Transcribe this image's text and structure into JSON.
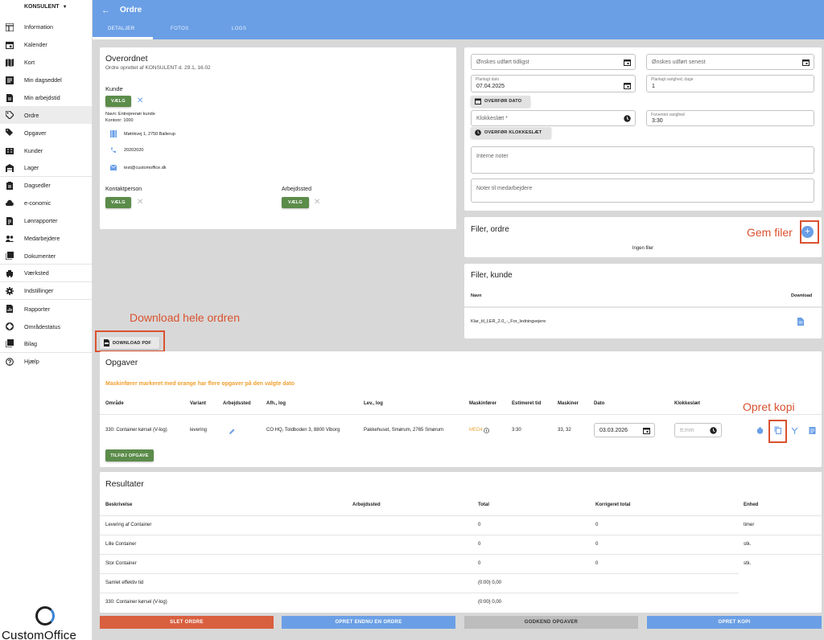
{
  "sidebar": {
    "user": "KONSULENT",
    "items": [
      {
        "label": "Information",
        "icon": "dashboard-icon"
      },
      {
        "label": "Kalender",
        "icon": "calendar-icon"
      },
      {
        "label": "Kort",
        "icon": "map-icon"
      },
      {
        "label": "Min dagseddel",
        "icon": "day-sheet-icon"
      },
      {
        "label": "Min arbejdstid",
        "icon": "worktime-icon"
      },
      {
        "label": "Ordre",
        "icon": "tag-icon"
      },
      {
        "label": "Opgaver",
        "icon": "tasks-icon"
      },
      {
        "label": "Kunder",
        "icon": "customers-icon"
      },
      {
        "label": "Lager",
        "icon": "warehouse-icon"
      },
      {
        "label": "Dagsedler",
        "icon": "clipboard-icon"
      },
      {
        "label": "e-conomic",
        "icon": "cloud-icon"
      },
      {
        "label": "Lønrapporter",
        "icon": "report-icon"
      },
      {
        "label": "Medarbejdere",
        "icon": "people-icon"
      },
      {
        "label": "Dokumenter",
        "icon": "documents-icon"
      },
      {
        "label": "Værksted",
        "icon": "workshop-icon"
      },
      {
        "label": "Indstillinger",
        "icon": "gear-icon"
      },
      {
        "label": "Rapporter",
        "icon": "chart-report-icon"
      },
      {
        "label": "Områdestatus",
        "icon": "area-status-icon"
      },
      {
        "label": "Bilag",
        "icon": "attachments-icon"
      },
      {
        "label": "Hjælp",
        "icon": "help-icon"
      }
    ],
    "logo_text": "CustomOffice"
  },
  "header": {
    "title": "Ordre",
    "tabs": [
      "DETALJER",
      "FOTOS",
      "LOGS"
    ]
  },
  "overview": {
    "title": "Overordnet",
    "subtitle": "Ordre oprettet af KONSULENT d. 29.1, 16.02",
    "customer_heading": "Kunde",
    "select_label": "VÆLG",
    "customer_name": "Navn: Entreprenør kunde",
    "customer_no": "Kontonr: 1000",
    "address": "Møtrikvej 1, 2750 Ballerup",
    "phone": "20202020",
    "email": "test@customoffice.dk",
    "contact_heading": "Kontaktperson",
    "workplace_heading": "Arbejdssted"
  },
  "dates": {
    "earliest_placeholder": "Ønskes udført tidligst",
    "latest_placeholder": "Ønskes udført senest",
    "planned_date_label": "Planlagt dato",
    "planned_date_value": "07.04.2025",
    "duration_label": "Planlagt varighed, dage",
    "duration_value": "1",
    "transfer_date_label": "OVERFØR DATO",
    "time_placeholder": "Klokkeslæt *",
    "expected_duration_label": "Forventet varighed",
    "expected_duration_value": "3:30",
    "transfer_time_label": "OVERFØR KLOKKESLÆT",
    "internal_notes_placeholder": "Interne noter",
    "employee_notes_placeholder": "Noter til medarbejdere"
  },
  "files_order": {
    "title": "Filer, ordre",
    "empty": "Ingen filer"
  },
  "files_customer": {
    "title": "Filer, kunde",
    "col_name": "Navn",
    "col_download": "Download",
    "file_name": "Klar_til_LER_2.0_-_For_ledningsejere"
  },
  "annotations": {
    "save_files": "Gem filer",
    "download_all": "Download hele ordren",
    "create_copy": "Opret kopi"
  },
  "download_pdf_label": "DOWNLOAD PDF",
  "tasks": {
    "title": "Opgaver",
    "warning": "Maskinfører markeret med orange har flere opgaver på den valgte dato",
    "headers": [
      "Område",
      "Variant",
      "Arbejdssted",
      "Afh., log",
      "Lev., log",
      "Maskinfører",
      "Estimeret tid",
      "Maskiner",
      "Dato",
      "Klokkeslæt"
    ],
    "row": {
      "area": "330: Container kørsel (V-log)",
      "variant": "levering",
      "pickup": "CO HQ, Toldboden 3, 8800 Viborg",
      "delivery": "Pakkehuset, Smørum, 2765 Smørum",
      "operator": "MED4",
      "estimated": "3:30",
      "machines": "33, 32",
      "date": "03.03.2026",
      "time_placeholder": "tt:mm"
    },
    "add_label": "TILFØJ OPGAVE",
    "colors": {
      "warning": "#f0a030",
      "operator": "#e8a33a"
    }
  },
  "results": {
    "title": "Resultater",
    "headers": [
      "Beskrivelse",
      "Arbejdssted",
      "Total",
      "Korrigeret total",
      "Enhed"
    ],
    "rows": [
      {
        "desc": "Levering af Container",
        "workplace": "",
        "total": "0",
        "corrected": "0",
        "unit": "timer"
      },
      {
        "desc": "Lille Container",
        "workplace": "",
        "total": "0",
        "corrected": "0",
        "unit": "stk."
      },
      {
        "desc": "Stor Container",
        "workplace": "",
        "total": "0",
        "corrected": "0",
        "unit": "stk."
      },
      {
        "desc": "Samlet effektiv tid",
        "workplace": "",
        "total": "(0:00) 0,00",
        "corrected": "",
        "unit": ""
      },
      {
        "desc": "330: Container kørsel (V-log)",
        "workplace": "",
        "total": "(0:00) 0,00",
        "corrected": "",
        "unit": ""
      }
    ]
  },
  "footer": {
    "delete": "SLET ORDRE",
    "create_another": "OPRET ENDNU EN ORDRE",
    "approve": "GODKEND OPGAVER",
    "create_copy": "OPRET KOPI",
    "colors": {
      "delete": "#d9603f",
      "primary": "#6a9fe6",
      "approve": "#bdbdbd"
    }
  }
}
